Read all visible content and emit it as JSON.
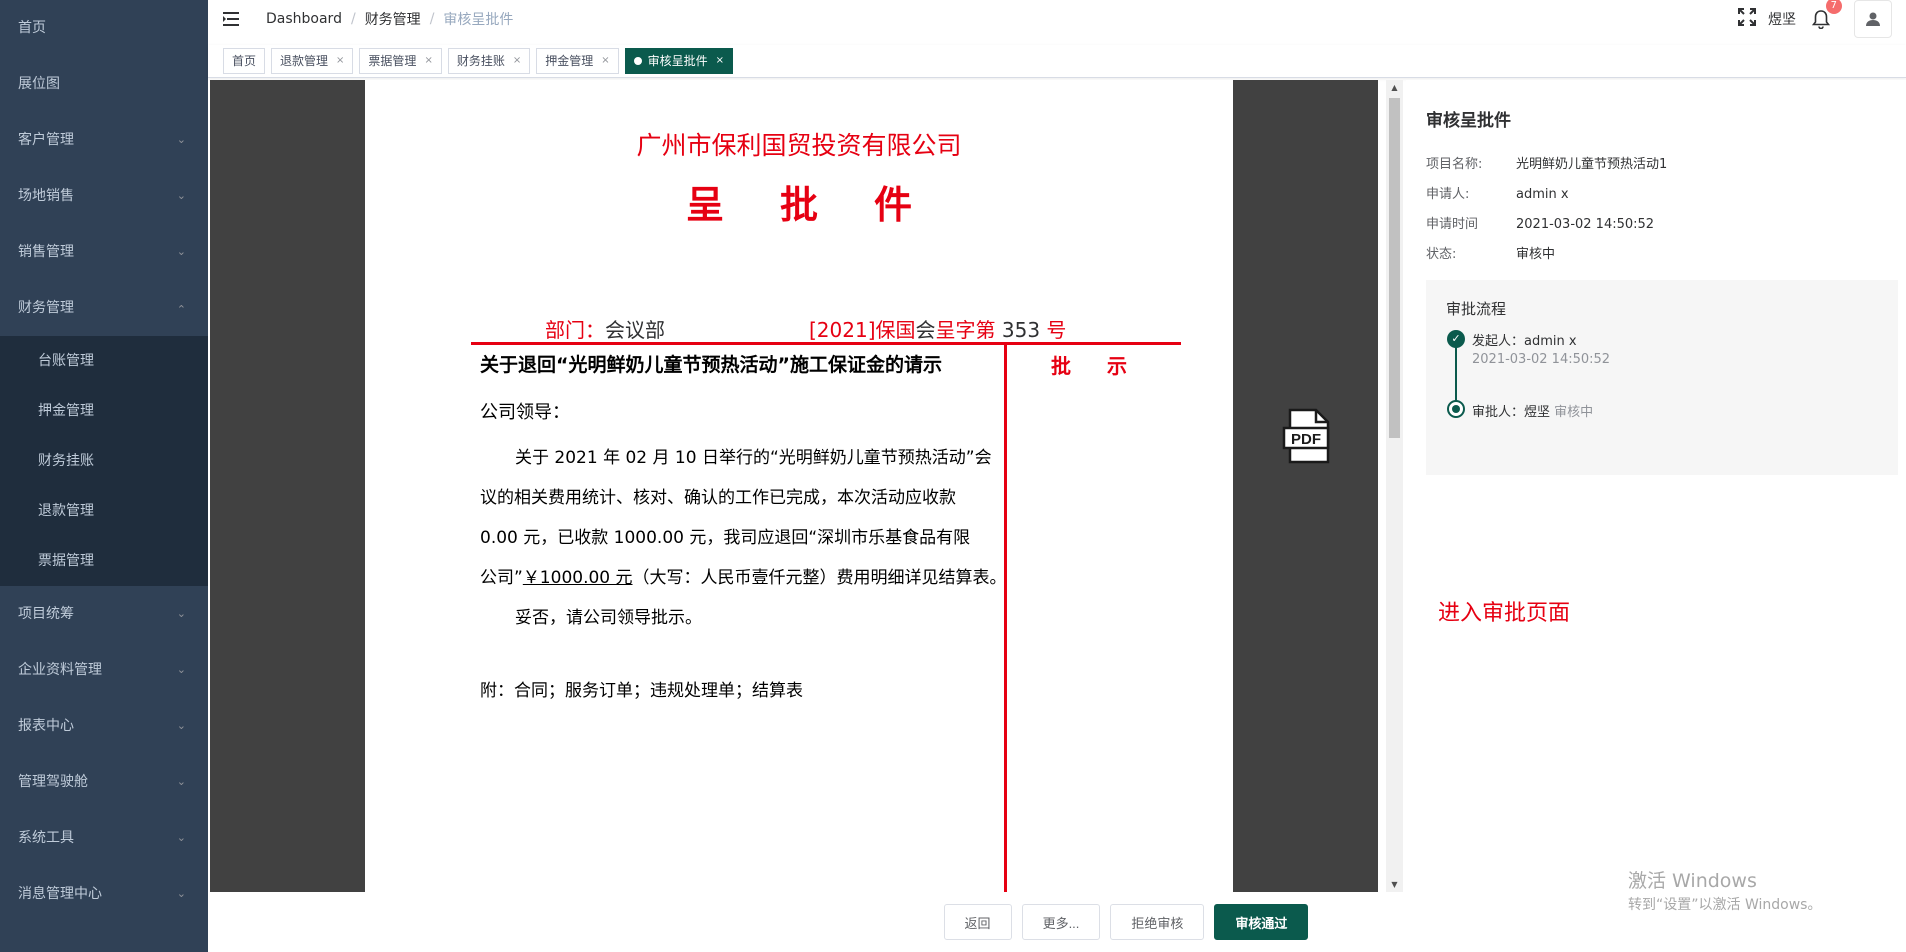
{
  "sidebar": {
    "items": [
      {
        "label": "首页",
        "has_arrow": false
      },
      {
        "label": "展位图",
        "has_arrow": false
      },
      {
        "label": "客户管理",
        "has_arrow": true
      },
      {
        "label": "场地销售",
        "has_arrow": true
      },
      {
        "label": "销售管理",
        "has_arrow": true
      },
      {
        "label": "财务管理",
        "has_arrow": true,
        "expanded": true
      }
    ],
    "finance_sub": [
      {
        "label": "台账管理"
      },
      {
        "label": "押金管理"
      },
      {
        "label": "财务挂账"
      },
      {
        "label": "退款管理"
      },
      {
        "label": "票据管理"
      }
    ],
    "items_after": [
      {
        "label": "项目统筹"
      },
      {
        "label": "企业资料管理"
      },
      {
        "label": "报表中心"
      },
      {
        "label": "管理驾驶舱"
      },
      {
        "label": "系统工具"
      },
      {
        "label": "消息管理中心"
      }
    ]
  },
  "header": {
    "breadcrumb": [
      "Dashboard",
      "财务管理",
      "审核呈批件"
    ],
    "username": "煜坚",
    "notification_count": "7"
  },
  "tags": [
    {
      "label": "首页",
      "closable": false,
      "active": false
    },
    {
      "label": "退款管理",
      "closable": true,
      "active": false
    },
    {
      "label": "票据管理",
      "closable": true,
      "active": false
    },
    {
      "label": "财务挂账",
      "closable": true,
      "active": false
    },
    {
      "label": "押金管理",
      "closable": true,
      "active": false
    },
    {
      "label": "审核呈批件",
      "closable": true,
      "active": true
    }
  ],
  "document": {
    "company": "广州市保利国贸投资有限公司",
    "title": "呈批件",
    "dept_label": "部门：",
    "dept_value": "会议部",
    "docno_prefix": "[2021]",
    "docno_org": "保国",
    "docno_mid": "会",
    "docno_type": "呈字第",
    "docno_num": " 353 ",
    "docno_suffix": "号",
    "pishi": "批示",
    "subject": "关于退回“光明鲜奶儿童节预热活动”施工保证金的请示",
    "greeting": "公司领导：",
    "body_line1": "关于 2021 年 02 月 10 日举行的“光明鲜奶儿童节预热活动”会",
    "body_line2": "议的相关费用统计、核对、确认的工作已完成，本次活动应收款",
    "body_line3": "0.00 元，已收款 1000.00 元，我司应退回“深圳市乐基食品有限",
    "body_line4_a": "公司”",
    "body_line4_u": "￥1000.00 元",
    "body_line4_b": "（大写：人民币壹仟元整）费用明细详见结算表。",
    "body_line5": "妥否，请公司领导批示。",
    "attachments": "附：合同；服务订单；违规处理单；结算表"
  },
  "panel": {
    "title": "审核呈批件",
    "project_label": "项目名称:",
    "project_value": "光明鲜奶儿童节预热活动1",
    "applicant_label": "申请人:",
    "applicant_value": "admin x",
    "time_label": "申请时间",
    "time_value": "2021-03-02 14:50:52",
    "status_label": "状态:",
    "status_value": "审核中",
    "flow_title": "审批流程",
    "step1_label": "发起人：admin x",
    "step1_time": "2021-03-02 14:50:52",
    "step2_label": "审批人：煜坚",
    "step2_status": "审核中",
    "annotation": "进入审批页面",
    "watermark_line1": "激活 Windows",
    "watermark_line2": "转到“设置”以激活 Windows。"
  },
  "footer": {
    "back": "返回",
    "more": "更多...",
    "reject": "拒绝审核",
    "approve": "审核通过"
  },
  "colors": {
    "sidebar_bg": "#304156",
    "accent": "#0b5a4d",
    "document_red": "#e60012"
  },
  "icons": [
    "hamburger-icon",
    "fullscreen-icon",
    "bell-icon",
    "user-icon",
    "pdf-icon",
    "chevron-down-icon",
    "chevron-up-icon",
    "check-icon",
    "close-icon"
  ]
}
